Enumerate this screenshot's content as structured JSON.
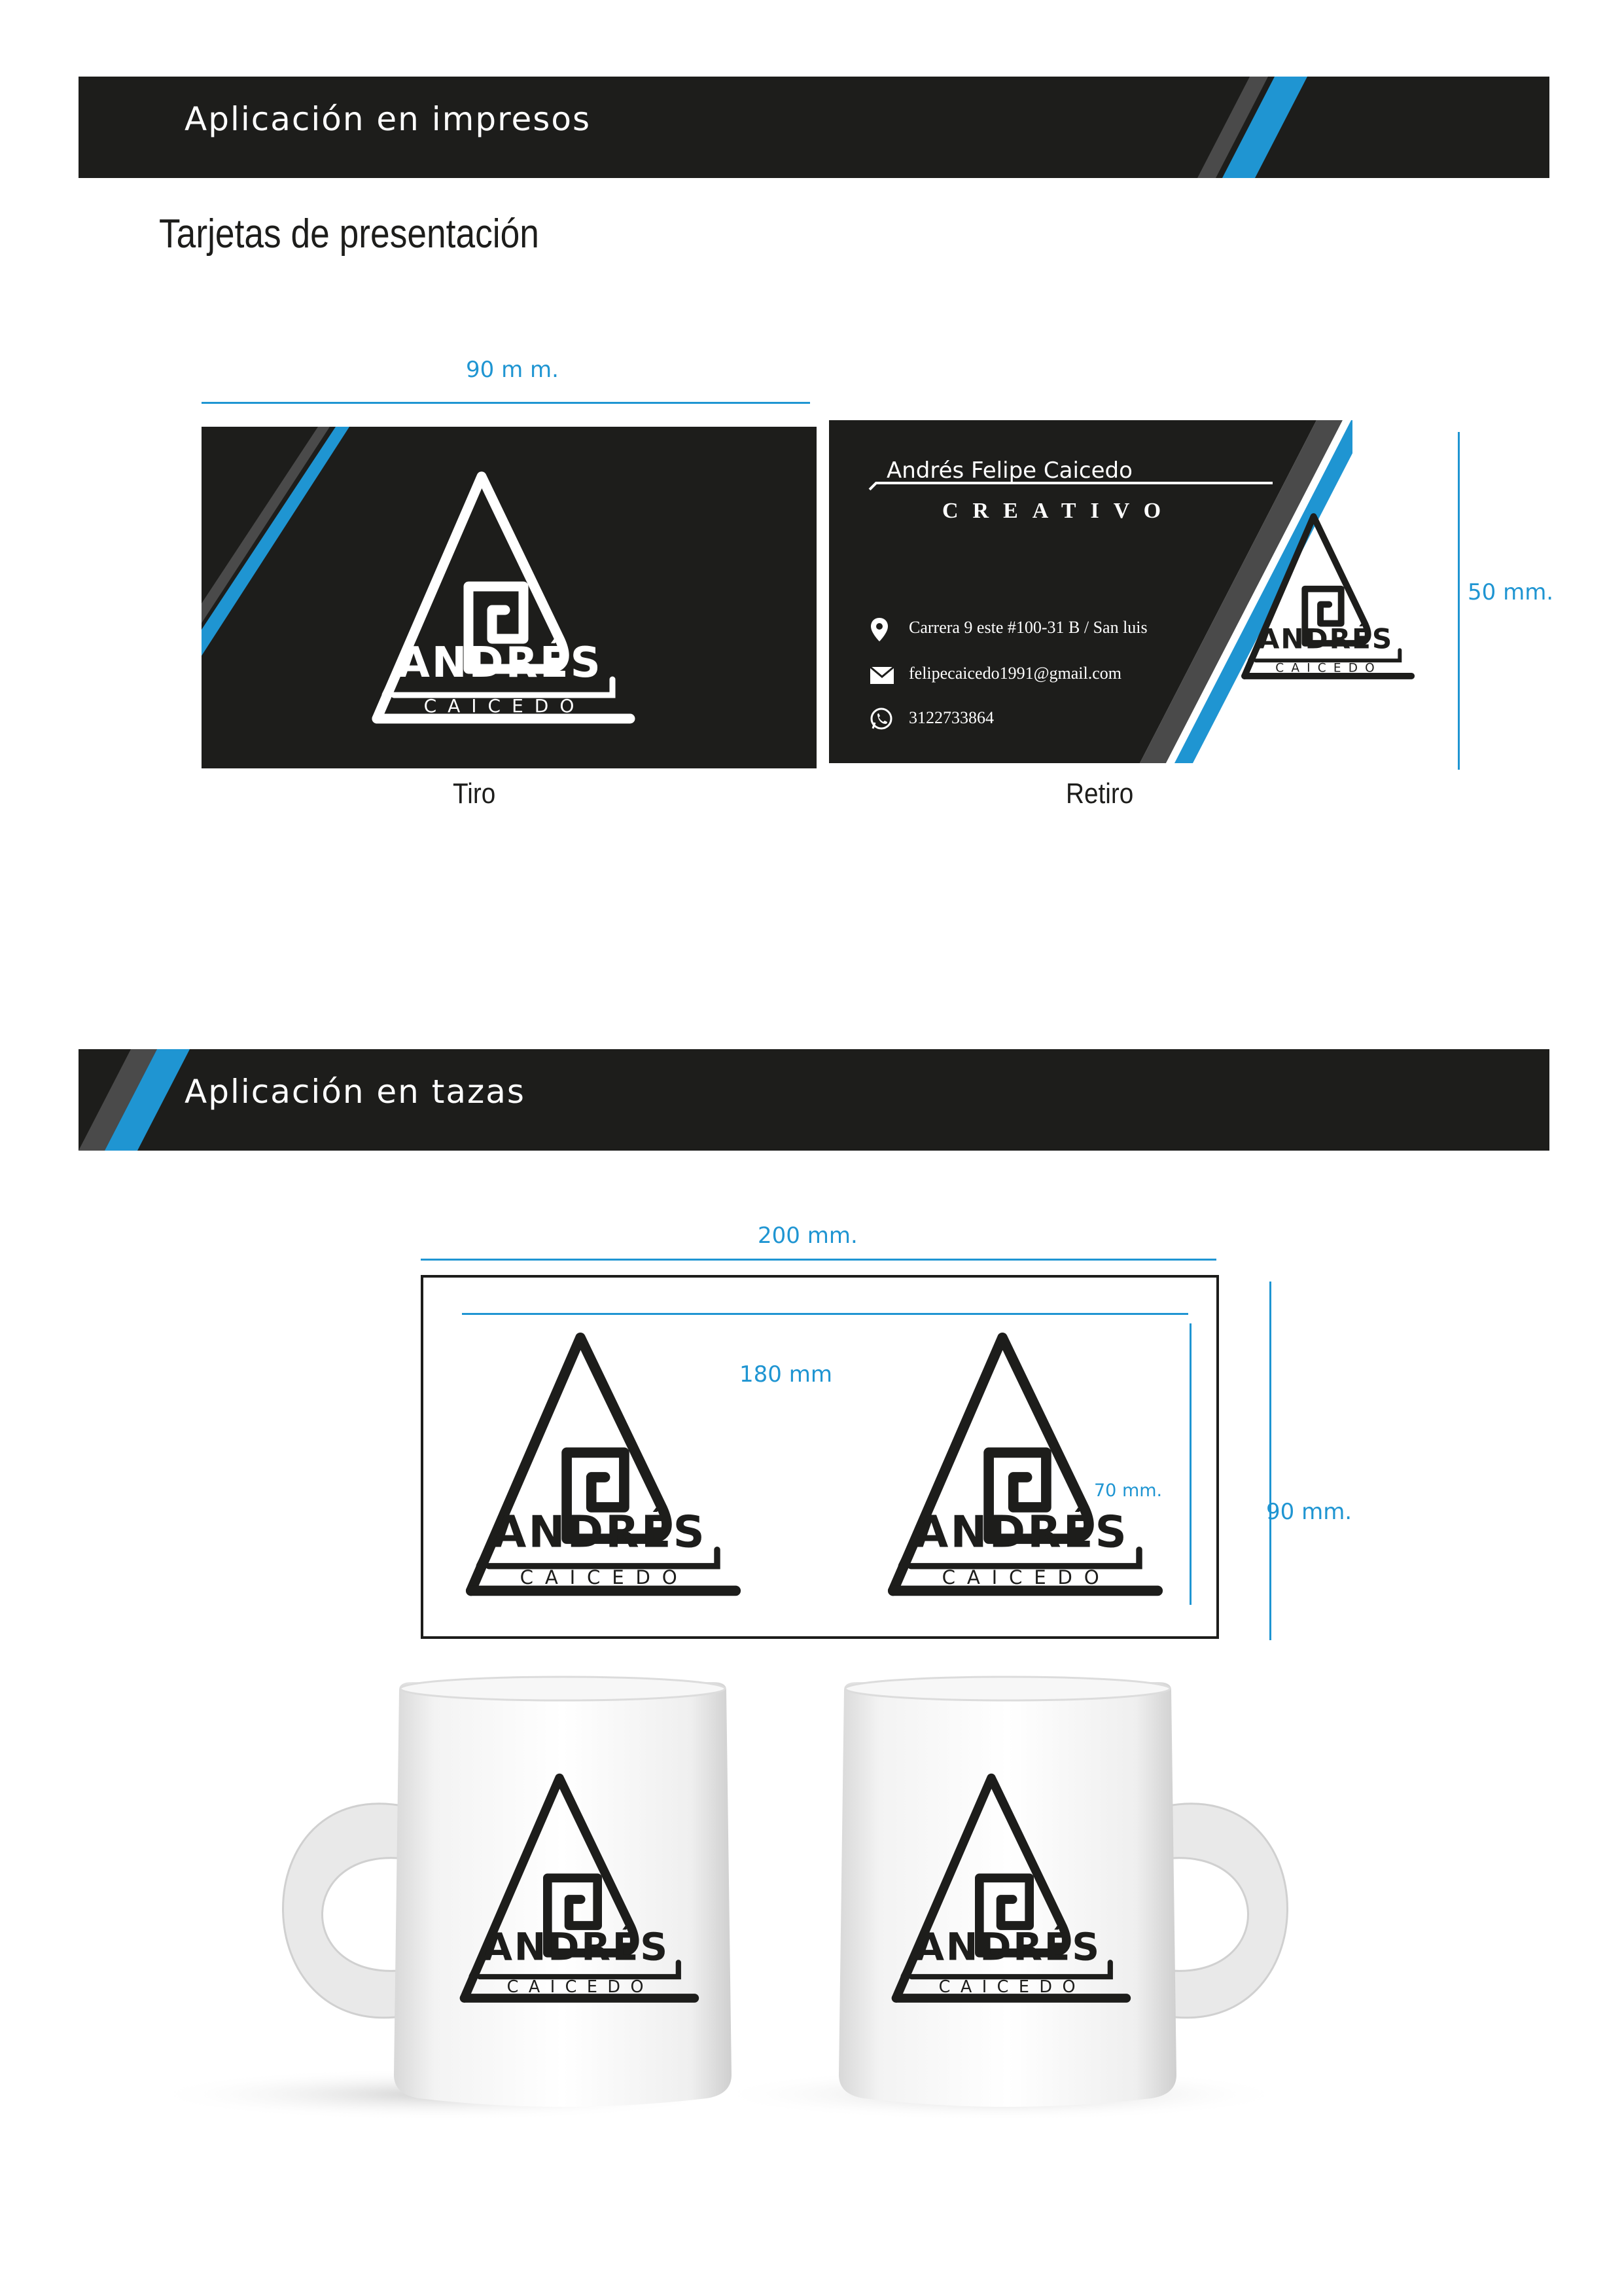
{
  "sections": {
    "prints_title": "Aplicación en impresos",
    "cards_subtitle": "Tarjetas de presentación",
    "mugs_title": "Aplicación en tazas"
  },
  "business_card": {
    "width_label": "90 m m.",
    "height_label": "50 mm.",
    "front_label": "Tiro",
    "back_label": "Retiro",
    "name": "Andrés Felipe Caicedo",
    "role": "CREATIVO",
    "address": "Carrera 9 este #100-31 B / San luis",
    "email": "felipecaicedo1991@gmail.com",
    "phone": "3122733864"
  },
  "logo": {
    "main": "ANDRÉS",
    "sub": "CAICEDO"
  },
  "mug_template": {
    "width_label": "200 mm.",
    "inner_width_label": "180 mm",
    "height_label": "90 mm.",
    "inner_height_label": "70 mm."
  },
  "colors": {
    "dark": "#1d1d1b",
    "accent_blue": "#1f95d2",
    "accent_gray": "#4a4a4a"
  }
}
